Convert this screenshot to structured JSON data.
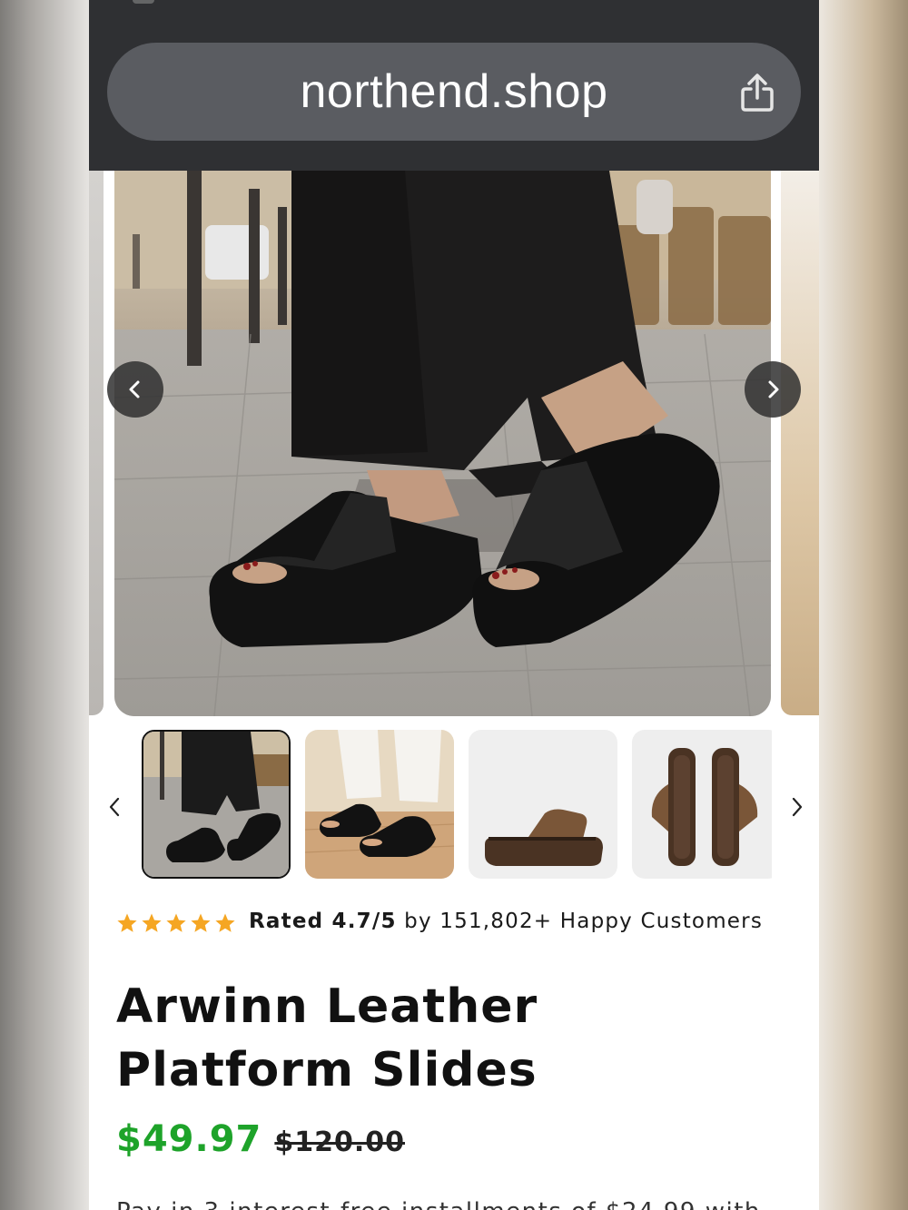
{
  "browser": {
    "url": "northend.shop",
    "share_icon": "share-icon"
  },
  "gallery": {
    "prev_icon": "chevron-left-icon",
    "next_icon": "chevron-right-icon",
    "thumbnails": [
      {
        "name": "thumb-street-black",
        "active": true
      },
      {
        "name": "thumb-beige-floor-black",
        "active": false
      },
      {
        "name": "thumb-brown-side",
        "active": false
      },
      {
        "name": "thumb-brown-top",
        "active": false
      }
    ]
  },
  "rating": {
    "stars": 5,
    "star_color": "#f5a623",
    "label": "Rated 4.7/5",
    "suffix": " by 151,802+ Happy Customers"
  },
  "product": {
    "title": "Arwinn Leather Platform Slides",
    "price": "$49.97",
    "compare_price": "$120.00",
    "price_color": "#1ea32a"
  },
  "description": {
    "partial_line": "Pay in 3 interest-free installments of $24.99 with"
  }
}
